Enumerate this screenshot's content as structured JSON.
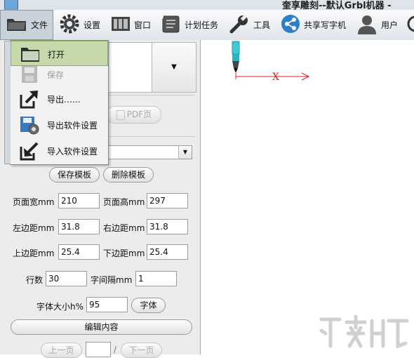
{
  "window": {
    "title": "奎享雕刻--默认Grbl机器 -"
  },
  "toolbar": {
    "items": [
      {
        "label": "文件"
      },
      {
        "label": "设置"
      },
      {
        "label": "窗口"
      },
      {
        "label": "计划任务"
      },
      {
        "label": "工具"
      },
      {
        "label": "共享写字机"
      },
      {
        "label": "用户"
      }
    ]
  },
  "file_menu": {
    "items": [
      {
        "label": "打开",
        "state": "highlighted"
      },
      {
        "label": "保存",
        "state": "disabled"
      },
      {
        "label": "导出……"
      },
      {
        "label": "导出软件设置"
      },
      {
        "label": "导入软件设置"
      }
    ]
  },
  "left_panel": {
    "pdf_button": "PDF页",
    "save_template": "保存模板",
    "delete_template": "删除模板",
    "fields": {
      "page_width": {
        "label": "页面宽mm",
        "value": "210"
      },
      "page_height": {
        "label": "页面高mm",
        "value": "297"
      },
      "margin_left": {
        "label": "左边距mm",
        "value": "31.8"
      },
      "margin_right": {
        "label": "右边距mm",
        "value": "31.8"
      },
      "margin_top": {
        "label": "上边距mm",
        "value": "25.4"
      },
      "margin_bottom": {
        "label": "下边距mm",
        "value": "25.4"
      },
      "rows": {
        "label": "行数",
        "value": "30"
      },
      "char_spacing": {
        "label": "字间隔mm",
        "value": "1"
      },
      "font_size": {
        "label": "字体大小h%",
        "value": "95"
      }
    },
    "font_button": "字体",
    "edit_content": "编辑内容",
    "prev_page": "上一页",
    "page_sep": "/",
    "next_page": "下一页"
  },
  "canvas": {
    "axis_label": "X"
  },
  "colors": {
    "axis_red": "#e0201c",
    "menu_highlight": "#c6d9aa",
    "pen_cyan": "#3fc9d6"
  }
}
